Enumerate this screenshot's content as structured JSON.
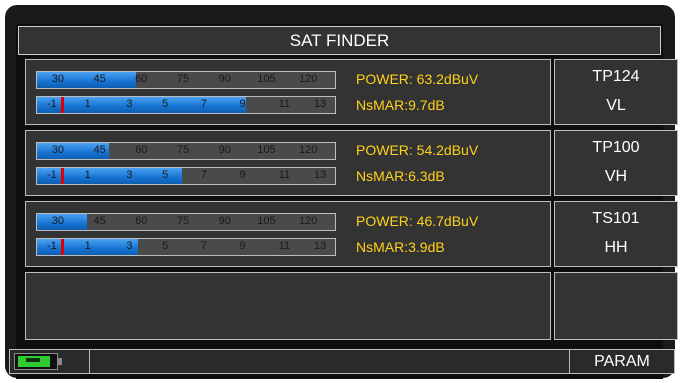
{
  "header": {
    "title": "SAT FINDER"
  },
  "rows": [
    {
      "power": "POWER:  63.2dBuV",
      "nsmar": "NsMAR:9.7dB",
      "tp_name": "TP124",
      "tp_pol": "VL",
      "power_level": 63.2,
      "nsmar_level": 9.7,
      "marker_value": -0.2
    },
    {
      "power": "POWER:  54.2dBuV",
      "nsmar": "NsMAR:6.3dB",
      "tp_name": "TP100",
      "tp_pol": "VH",
      "power_level": 54.2,
      "nsmar_level": 6.3,
      "marker_value": -0.2
    },
    {
      "power": "POWER:  46.7dBuV",
      "nsmar": "NsMAR:3.9dB",
      "tp_name": "TS101",
      "tp_pol": "HH",
      "power_level": 46.7,
      "nsmar_level": 3.9,
      "marker_value": -0.2
    }
  ],
  "scales": {
    "power_ticks": [
      "30",
      "45",
      "60",
      "75",
      "90",
      "105",
      "120"
    ],
    "power_min": 30,
    "power_max": 130,
    "nsmar_ticks": [
      "-1",
      "1",
      "3",
      "5",
      "7",
      "9",
      "11",
      "13"
    ],
    "nsmar_min": -1.5,
    "nsmar_max": 14.5
  },
  "footer": {
    "param_label": "PARAM",
    "battery_icon": "battery-charging-icon"
  },
  "colors": {
    "accent_text": "#ffd21a",
    "bar_fill": "#1673d2",
    "marker": "#e00000",
    "battery": "#2ecc2e"
  }
}
